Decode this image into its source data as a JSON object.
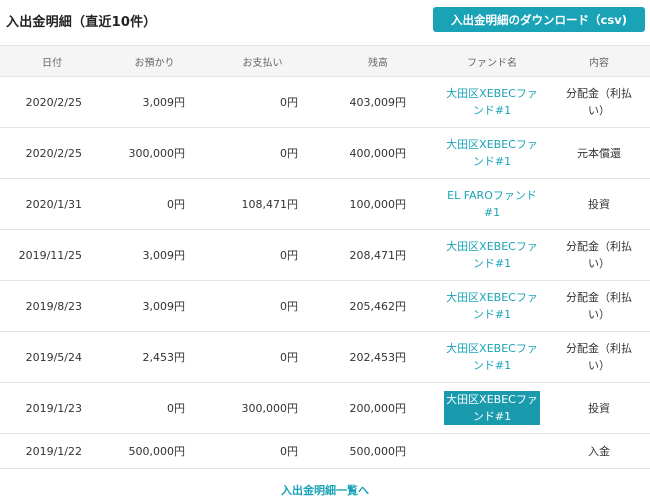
{
  "header": {
    "title": "入出金明細（直近10件）",
    "download_label": "入出金明細のダウンロード（csv)"
  },
  "table": {
    "columns": [
      "日付",
      "お預かり",
      "お支払い",
      "残高",
      "ファンド名",
      "内容"
    ],
    "rows": [
      {
        "date": "2020/2/25",
        "deposit": "3,009円",
        "payment": "0円",
        "balance": "403,009円",
        "fund_line1": "大田区XEBECファ",
        "fund_line2": "ンド#1",
        "type_line1": "分配金（利払",
        "type_line2": "い）"
      },
      {
        "date": "2020/2/25",
        "deposit": "300,000円",
        "payment": "0円",
        "balance": "400,000円",
        "fund_line1": "大田区XEBECファ",
        "fund_line2": "ンド#1",
        "type_line1": "元本償還",
        "type_line2": ""
      },
      {
        "date": "2020/1/31",
        "deposit": "0円",
        "payment": "108,471円",
        "balance": "100,000円",
        "fund_line1": "EL FAROファンド",
        "fund_line2": "#1",
        "type_line1": "投資",
        "type_line2": ""
      },
      {
        "date": "2019/11/25",
        "deposit": "3,009円",
        "payment": "0円",
        "balance": "208,471円",
        "fund_line1": "大田区XEBECファ",
        "fund_line2": "ンド#1",
        "type_line1": "分配金（利払",
        "type_line2": "い）"
      },
      {
        "date": "2019/8/23",
        "deposit": "3,009円",
        "payment": "0円",
        "balance": "205,462円",
        "fund_line1": "大田区XEBECファ",
        "fund_line2": "ンド#1",
        "type_line1": "分配金（利払",
        "type_line2": "い）"
      },
      {
        "date": "2019/5/24",
        "deposit": "2,453円",
        "payment": "0円",
        "balance": "202,453円",
        "fund_line1": "大田区XEBECファ",
        "fund_line2": "ンド#1",
        "type_line1": "分配金（利払",
        "type_line2": "い）"
      },
      {
        "date": "2019/1/23",
        "deposit": "0円",
        "payment": "300,000円",
        "balance": "200,000円",
        "fund_line1": "大田区XEBECファ",
        "fund_line2": "ンド#1",
        "type_line1": "投資",
        "type_line2": "",
        "fund_selected": true
      },
      {
        "date": "2019/1/22",
        "deposit": "500,000円",
        "payment": "0円",
        "balance": "500,000円",
        "fund_line1": "",
        "fund_line2": "",
        "type_line1": "入金",
        "type_line2": ""
      }
    ]
  },
  "footer": {
    "link_label": "入出金明細一覧へ"
  },
  "colors": {
    "accent": "#1aa3b7",
    "header_bg": "#f5f5f5",
    "border": "#e4e4e4"
  }
}
